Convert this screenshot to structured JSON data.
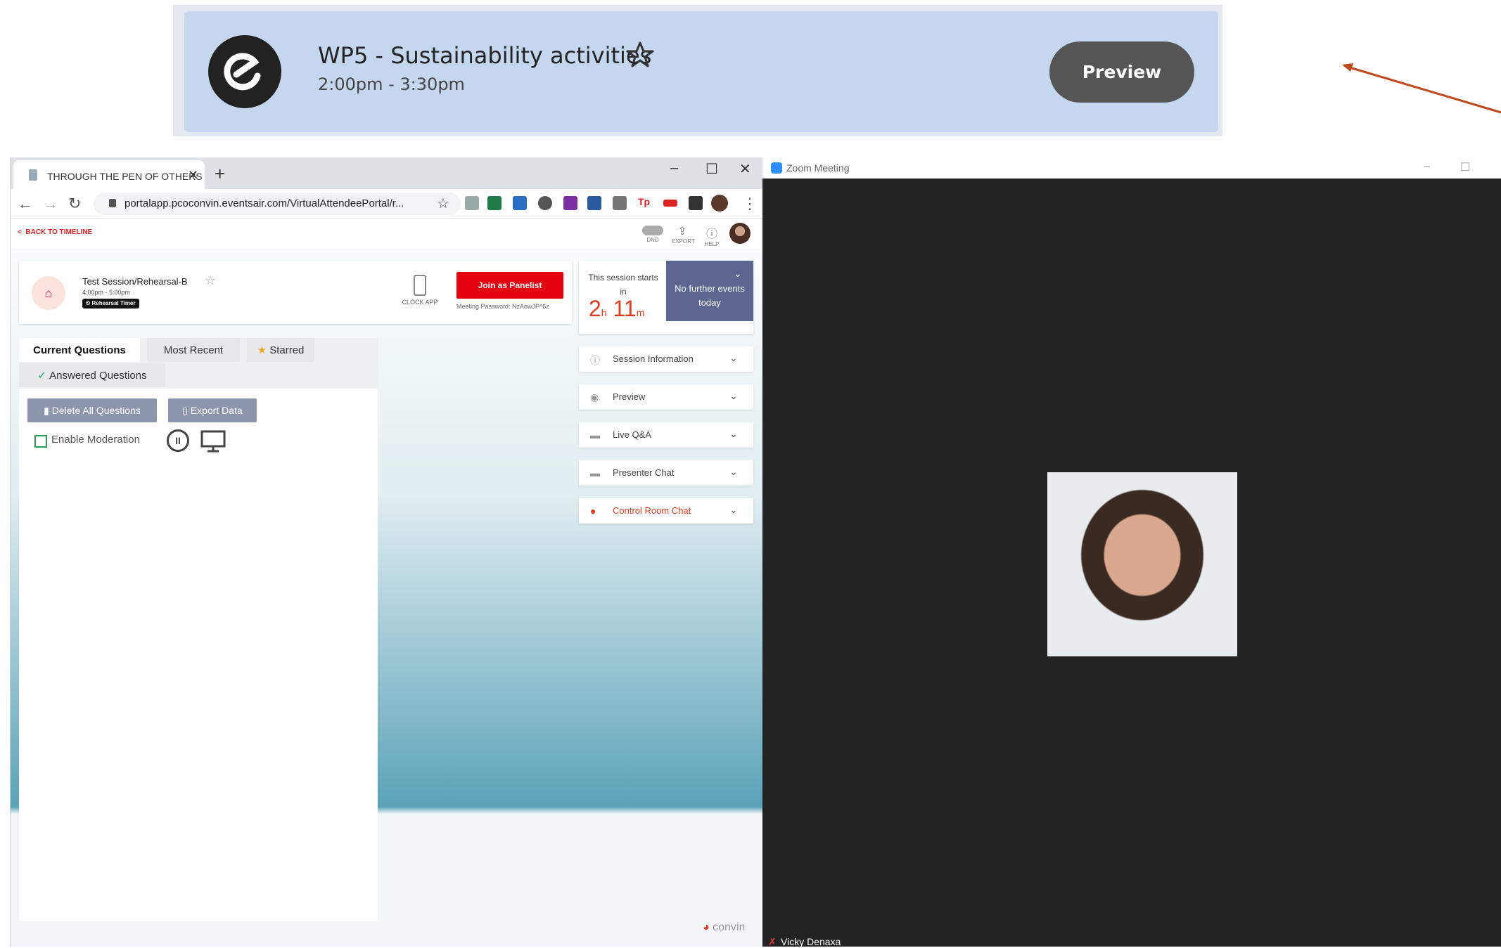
{
  "banner": {
    "title": "WP5 - Sustainability activities",
    "time": "2:00pm - 3:30pm",
    "preview_label": "Preview"
  },
  "browser": {
    "tab_title": "THROUGH THE PEN OF OTHERS",
    "tab_close": "✕",
    "new_tab": "+",
    "url": "portalapp.pcoconvin.eventsair.com/VirtualAttendeePortal/r...",
    "back_label": "BACK TO TIMELINE",
    "header_icons": {
      "dnd": "DND",
      "export": "EXPORT",
      "help": "HELP"
    },
    "window_controls": {
      "minimize": "–",
      "maximize": "☐",
      "close": "✕"
    }
  },
  "session": {
    "title": "Test Session/Rehearsal-B",
    "time": "4:00pm - 5:00pm",
    "badge": "Rehearsal Timer",
    "clock_app": "CLOCK APP",
    "join_label": "Join as Panelist",
    "meeting_password": "Meeting Password: NzAowJP^6z"
  },
  "countdown": {
    "label": "This session starts in",
    "hours": "2",
    "hours_unit": "h",
    "minutes": "11",
    "minutes_unit": "m",
    "no_events": "No further events today"
  },
  "accordions": [
    {
      "label": "Session Information",
      "icon": "info-icon"
    },
    {
      "label": "Preview",
      "icon": "eye-icon"
    },
    {
      "label": "Live Q&A",
      "icon": "chat-icon"
    },
    {
      "label": "Presenter Chat",
      "icon": "chats-icon"
    },
    {
      "label": "Control Room Chat",
      "icon": "person-icon",
      "accent": "#e03a1e"
    }
  ],
  "qa": {
    "tabs": [
      "Current Questions",
      "Most Recent",
      "Starred",
      "Answered Questions"
    ],
    "delete_label": "Delete All Questions",
    "export_label": "Export Data",
    "moderation_label": "Enable Moderation"
  },
  "convin": "convin",
  "zoom": {
    "title": "Zoom Meeting",
    "participant": "Vicky Denaxa"
  },
  "colors": {
    "join": "#e4000f",
    "accent": "#e03a1e",
    "banner": "#c5d7ef",
    "no_events": "#5c6690"
  }
}
